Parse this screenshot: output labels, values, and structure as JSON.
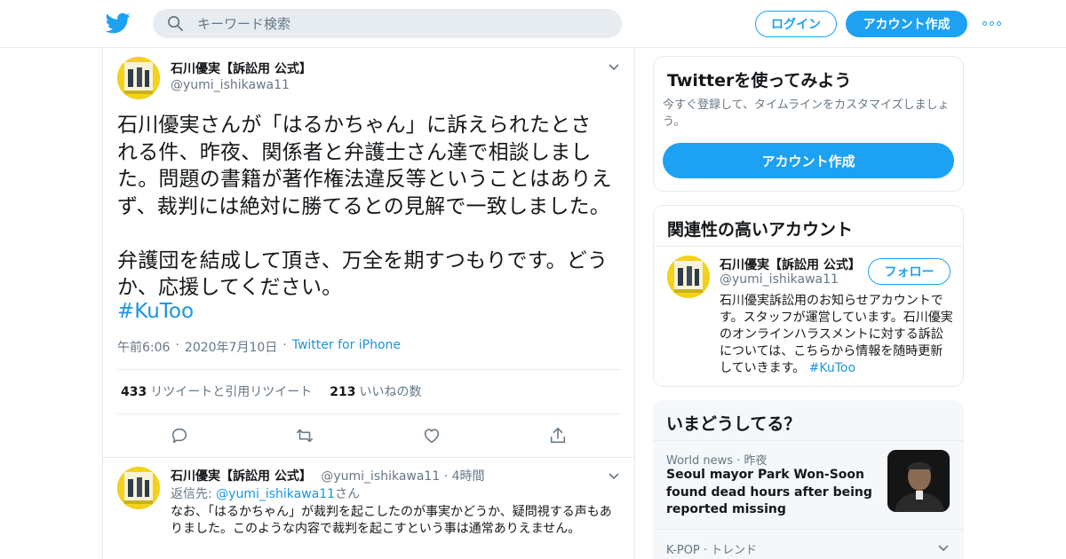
{
  "header": {
    "search_placeholder": "キーワード検索",
    "login_label": "ログイン",
    "signup_label": "アカウント作成",
    "brand_color": "#1da1f2"
  },
  "tweet": {
    "name": "石川優実【訴訟用 公式】",
    "handle": "@yumi_ishikawa11",
    "text": "石川優実さんが「はるかちゃん」に訴えられたとさ\nれる件、昨夜、関係者と弁護士さん達で相談しまし\nた。問題の書籍が著作権法違反等ということはありえ\nず、裁判には絶対に勝てるとの見解で一致しました。\n\n弁護団を結成して頂き、万全を期すつもりです。どう\nか、応援してください。",
    "hashtag": "#KuToo",
    "time": "午前6:06",
    "date": "2020年7月10日",
    "source": "Twitter for iPhone",
    "retweets_count": "433",
    "retweets_label": "リツイートと引用リツイート",
    "likes_count": "213",
    "likes_label": "いいねの数"
  },
  "reply": {
    "name": "石川優実【訴訟用 公式】",
    "handle": "@yumi_ishikawa11",
    "time": "4時間",
    "reply_prefix": "返信先: ",
    "reply_to": "@yumi_ishikawa11",
    "reply_suffix": "さん",
    "text": "なお、「はるかちゃん」が裁判を起こしたのが事実かどうか、疑問視する声もありました。このような内容で裁判を起こすという事は通常ありえません。"
  },
  "sidebar": {
    "try_title": "Twitterを使ってみよう",
    "try_desc": "今すぐ登録して、タイムラインをカスタマイズしましょう。",
    "try_button": "アカウント作成",
    "related_title": "関連性の高いアカウント",
    "related_name": "石川優実【訴訟用 公式】",
    "related_handle": "@yumi_ishikawa11",
    "follow_label": "フォロー",
    "related_bio": "石川優実訴訟用のお知らせアカウントです。スタッフが運営しています。石川優実のオンラインハラスメントに対する訴訟については、こちらから情報を随時更新していきます。 ",
    "related_bio_hashtag": "#KuToo",
    "trends_title": "いまどうしてる？",
    "trend1_category": "World news",
    "trend1_time": "昨夜",
    "trend1_headline": "Seoul mayor Park Won-Soon found dead hours after being reported missing",
    "trend2_category": "K-POP",
    "trend2_label": "トレンド"
  }
}
